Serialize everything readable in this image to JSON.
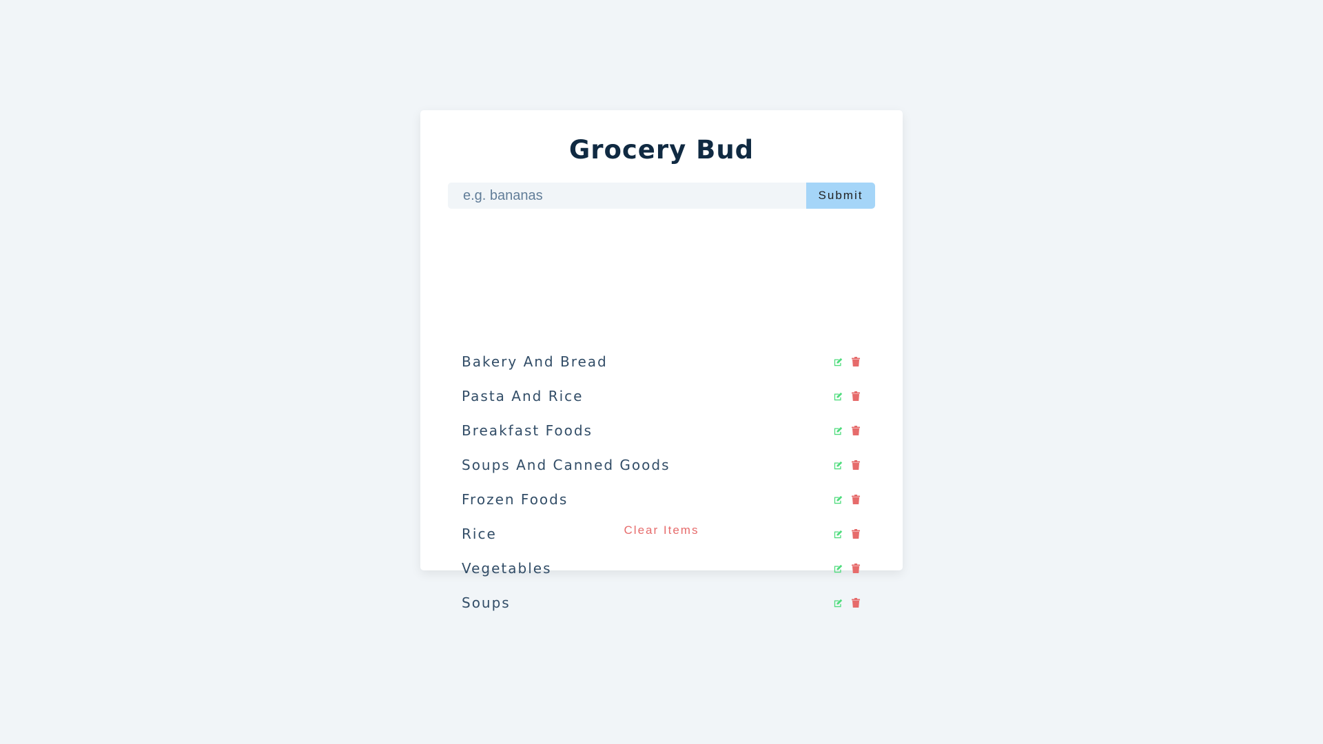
{
  "app": {
    "title": "Grocery Bud"
  },
  "form": {
    "input_value": "",
    "input_placeholder": "e.g. bananas",
    "submit_label": "Submit"
  },
  "items": [
    {
      "title": "Bakery And Bread"
    },
    {
      "title": "Pasta And Rice"
    },
    {
      "title": "Breakfast Foods"
    },
    {
      "title": "Soups And Canned Goods"
    },
    {
      "title": "Frozen Foods"
    },
    {
      "title": "Rice"
    },
    {
      "title": "Vegetables"
    },
    {
      "title": "Soups"
    }
  ],
  "icons": {
    "edit": "edit-icon",
    "delete": "trash-icon"
  },
  "colors": {
    "background": "#f1f5f8",
    "title": "#102a42",
    "submit": "#a5d5f8",
    "item_text": "#324d67",
    "edit": "#4fdc7d",
    "delete": "#e66b6b",
    "clear": "#e66b6b"
  },
  "clear_label": "Clear Items"
}
